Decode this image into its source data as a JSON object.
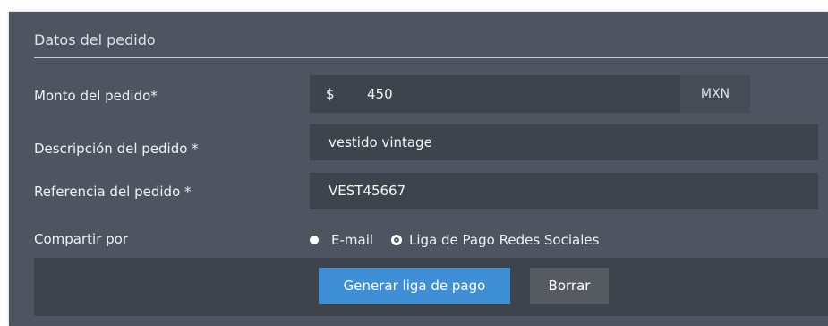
{
  "panel": {
    "title": "Datos del pedido"
  },
  "form": {
    "amount": {
      "label": "Monto del pedido*",
      "prefix": "$",
      "value": "450",
      "suffix": "MXN"
    },
    "description": {
      "label": "Descripción del pedido *",
      "value": "vestido vintage"
    },
    "reference": {
      "label": "Referencia del pedido *",
      "value": "VEST45667"
    },
    "share": {
      "label": "Compartir por",
      "options": [
        "E-mail",
        "Liga de Pago Redes Sociales"
      ],
      "selected": "Liga de Pago Redes Sociales"
    }
  },
  "actions": {
    "generate_label": "Generar liga de pago",
    "clear_label": "Borrar"
  },
  "colors": {
    "panel_bg": "#4e5560",
    "primary_button": "#3f8fd6",
    "secondary_button": "#565b62"
  }
}
